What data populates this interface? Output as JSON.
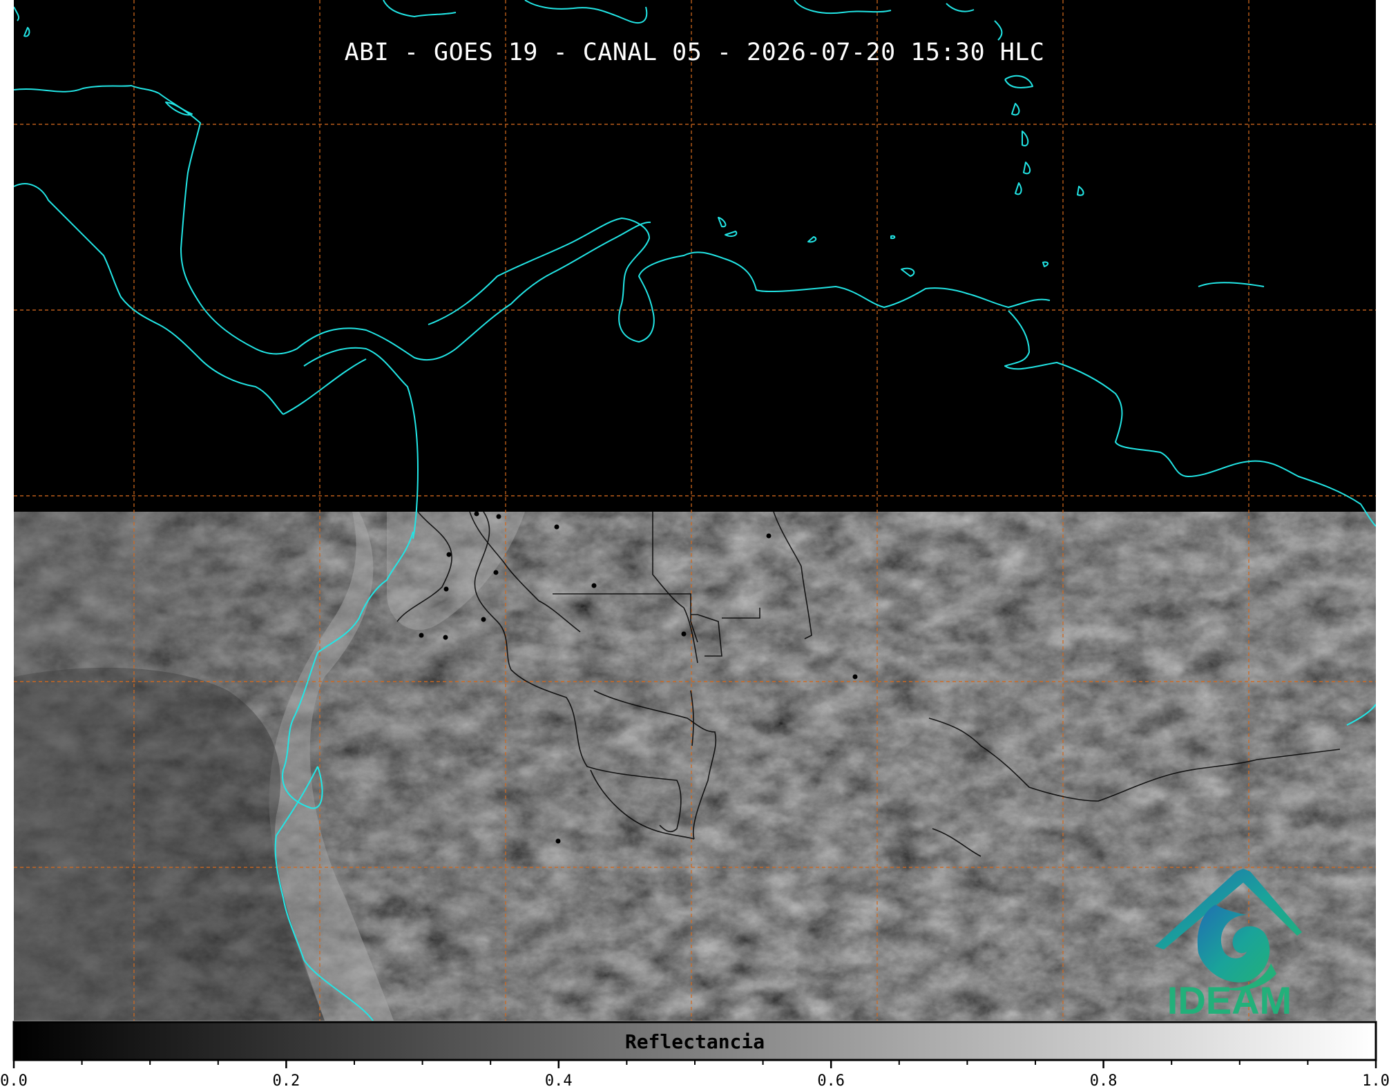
{
  "title": "ABI - GOES 19 - CANAL 05 - 2026-07-20 15:30 HLC",
  "colorbar": {
    "label": "Reflectancia",
    "ticks": [
      "0.0",
      "0.2",
      "0.4",
      "0.6",
      "0.8",
      "1.0"
    ],
    "min": 0.0,
    "max": 1.0,
    "cmap": "gray"
  },
  "logo": {
    "text": "IDEAM",
    "icon": "ideam-logo-icon",
    "colors": [
      "#1f6fb2",
      "#1aa39a",
      "#22b07a"
    ]
  },
  "map": {
    "grid": true,
    "grid_color": "#d2691e",
    "coastline_color": "#22e6e6",
    "border_color": "#000000",
    "night_color": "#000000"
  }
}
